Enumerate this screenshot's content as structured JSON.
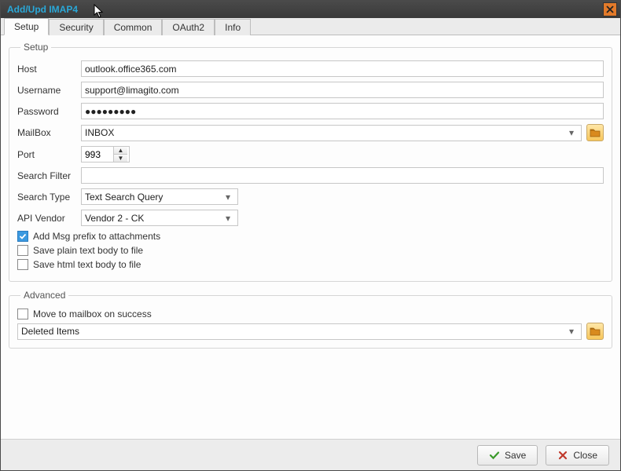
{
  "window": {
    "title": "Add/Upd IMAP4"
  },
  "tabs": [
    {
      "label": "Setup"
    },
    {
      "label": "Security"
    },
    {
      "label": "Common"
    },
    {
      "label": "OAuth2"
    },
    {
      "label": "Info"
    }
  ],
  "setup_group": {
    "legend": "Setup",
    "host_label": "Host",
    "host_value": "outlook.office365.com",
    "username_label": "Username",
    "username_value": "support@limagito.com",
    "password_label": "Password",
    "password_value": "●●●●●●●●●",
    "mailbox_label": "MailBox",
    "mailbox_value": "INBOX",
    "port_label": "Port",
    "port_value": "993",
    "searchfilter_label": "Search Filter",
    "searchfilter_value": "",
    "searchtype_label": "Search Type",
    "searchtype_value": "Text Search Query",
    "apivendor_label": "API Vendor",
    "apivendor_value": "Vendor 2 - CK",
    "check_msgprefix": "Add Msg prefix to attachments",
    "check_saveplain": "Save plain text body to file",
    "check_savehtml": "Save html text body to file"
  },
  "advanced_group": {
    "legend": "Advanced",
    "check_move": "Move to mailbox on success",
    "moveto_value": "Deleted Items"
  },
  "footer": {
    "save_label": "Save",
    "close_label": "Close"
  }
}
